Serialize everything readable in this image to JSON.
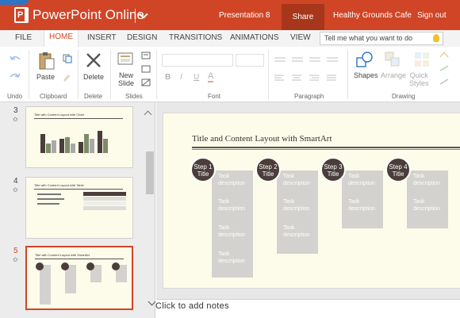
{
  "topbar": {
    "app_name": "PowerPoint Online",
    "doc_name": "Presentation 8",
    "share_label": "Share",
    "user_name": "Healthy Grounds Cafe",
    "signout_label": "Sign out",
    "accent_color": "#d04526"
  },
  "tabs": [
    {
      "label": "FILE"
    },
    {
      "label": "HOME"
    },
    {
      "label": "INSERT"
    },
    {
      "label": "DESIGN"
    },
    {
      "label": "TRANSITIONS"
    },
    {
      "label": "ANIMATIONS"
    },
    {
      "label": "VIEW"
    }
  ],
  "active_tab": "HOME",
  "tellme_placeholder": "Tell me what you want to do",
  "ribbon": {
    "undo_group": "Undo",
    "clipboard_group": "Clipboard",
    "paste_label": "Paste",
    "delete_label": "Delete",
    "delete_group": "Delete",
    "new_slide_label": [
      "New",
      "Slide"
    ],
    "slides_group": "Slides",
    "font_group": "Font",
    "paragraph_group": "Paragraph",
    "shapes_label": "Shapes",
    "arrange_label": "Arrange",
    "quick_styles_label": [
      "Quick",
      "Styles"
    ],
    "drawing_group": "Drawing"
  },
  "thumbnails": [
    {
      "number": "3",
      "title": "Title with Content Layout with Chart",
      "active": false
    },
    {
      "number": "4",
      "title": "Title with Content Layout with Table",
      "active": false
    },
    {
      "number": "5",
      "title": "Title with Content Layout with SmartArt",
      "active": true
    }
  ],
  "slide": {
    "title": "Title and Content Layout with SmartArt",
    "steps": [
      {
        "label": [
          "Step 1",
          "Title"
        ],
        "tasks": [
          "Task description",
          "Task description",
          "Task description",
          "Task description"
        ]
      },
      {
        "label": [
          "Step 2",
          "Title"
        ],
        "tasks": [
          "Task description",
          "Task description",
          "Task description"
        ]
      },
      {
        "label": [
          "Step 3",
          "Title"
        ],
        "tasks": [
          "Task description",
          "Task description"
        ]
      },
      {
        "label": [
          "Step 4",
          "Title"
        ],
        "tasks": [
          "Task description",
          "Task description"
        ]
      }
    ]
  },
  "notes_placeholder": "Click to add notes"
}
